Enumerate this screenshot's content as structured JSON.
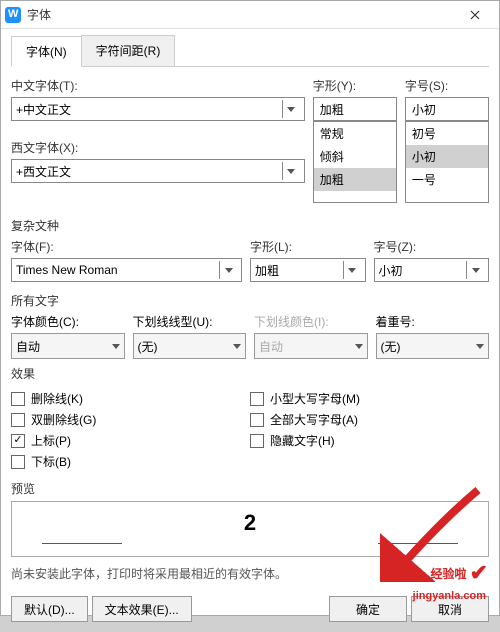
{
  "title": "字体",
  "tabs": [
    "字体(N)",
    "字符间距(R)"
  ],
  "active_tab": 0,
  "chinese_font": {
    "label": "中文字体(T):",
    "value": "+中文正文"
  },
  "style": {
    "label": "字形(Y):",
    "value": "加粗",
    "options": [
      "常规",
      "倾斜",
      "加粗"
    ],
    "selected_index": 2
  },
  "size": {
    "label": "字号(S):",
    "value": "小初",
    "options": [
      "初号",
      "小初",
      "一号"
    ],
    "selected_index": 1
  },
  "western_font": {
    "label": "西文字体(X):",
    "value": "+西文正文"
  },
  "complex": {
    "heading": "复杂文种",
    "font": {
      "label": "字体(F):",
      "value": "Times New Roman"
    },
    "style": {
      "label": "字形(L):",
      "value": "加粗"
    },
    "size": {
      "label": "字号(Z):",
      "value": "小初"
    }
  },
  "alltext": {
    "heading": "所有文字",
    "font_color": {
      "label": "字体颜色(C):",
      "value": "自动"
    },
    "underline": {
      "label": "下划线线型(U):",
      "value": "(无)"
    },
    "underline_color": {
      "label": "下划线颜色(I):",
      "value": "自动"
    },
    "emphasis": {
      "label": "着重号:",
      "value": "(无)"
    }
  },
  "effects": {
    "heading": "效果",
    "strikethrough": "删除线(K)",
    "double_strike": "双删除线(G)",
    "superscript": "上标(P)",
    "subscript": "下标(B)",
    "smallcaps": "小型大写字母(M)",
    "allcaps": "全部大写字母(A)",
    "hidden": "隐藏文字(H)",
    "checked": {
      "superscript": true
    }
  },
  "preview": {
    "heading": "预览",
    "sample": "2"
  },
  "note": "尚未安装此字体，打印时将采用最相近的有效字体。",
  "buttons": {
    "default": "默认(D)...",
    "text_effects": "文本效果(E)...",
    "ok": "确定",
    "cancel": "取消"
  },
  "watermark": {
    "brand": "经验啦",
    "url": "jingyanla.com"
  }
}
